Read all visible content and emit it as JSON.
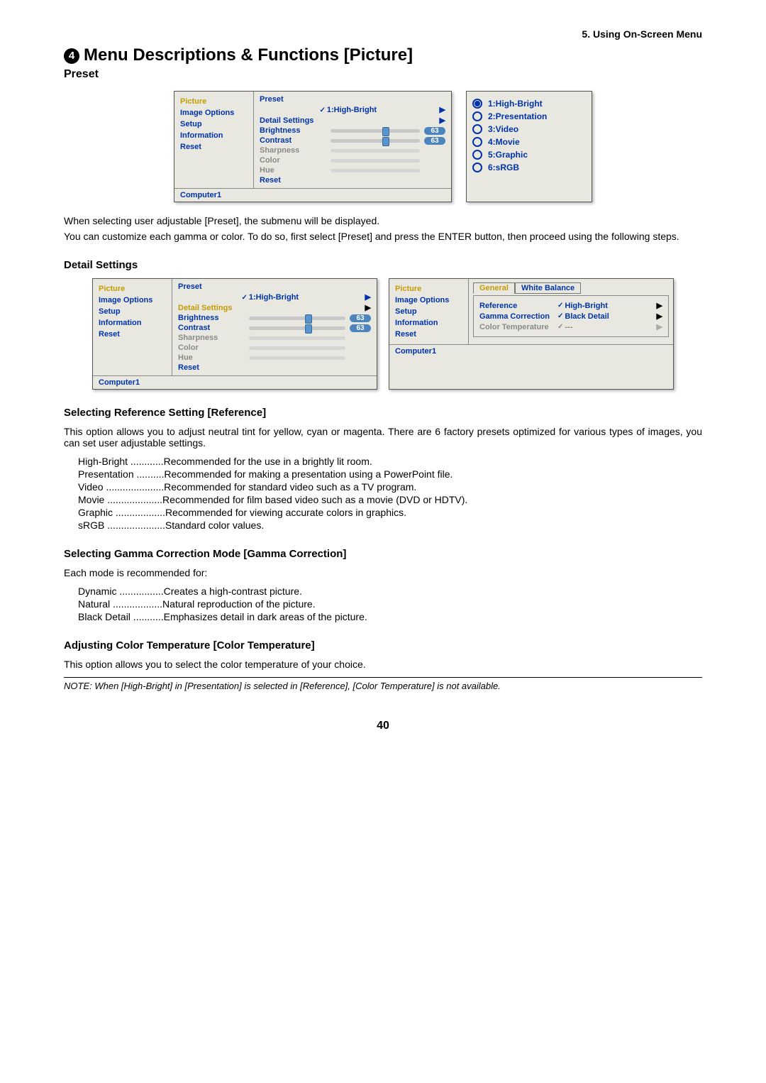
{
  "chapter": "5. Using On-Screen Menu",
  "title_number": "4",
  "title": "Menu Descriptions & Functions [Picture]",
  "preset_heading": "Preset",
  "osd1": {
    "side": [
      "Picture",
      "Image Options",
      "Setup",
      "Information",
      "Reset"
    ],
    "side_selected": 0,
    "preset_label": "Preset",
    "preset_value": "1:High-Bright",
    "detail": "Detail Settings",
    "brightness_label": "Brightness",
    "brightness_value": "63",
    "contrast_label": "Contrast",
    "contrast_value": "63",
    "sharpness_label": "Sharpness",
    "color_label": "Color",
    "hue_label": "Hue",
    "reset_label": "Reset",
    "status": "Computer1"
  },
  "popup": {
    "items": [
      "1:High-Bright",
      "2:Presentation",
      "3:Video",
      "4:Movie",
      "5:Graphic",
      "6:sRGB"
    ],
    "selected": 0
  },
  "para1": "When selecting user adjustable [Preset], the submenu will be displayed.",
  "para2": "You can customize each gamma or color. To do so, first select [Preset] and press the ENTER button, then proceed using the following steps.",
  "detail_heading": "Detail Settings",
  "osd2": {
    "side": [
      "Picture",
      "Image Options",
      "Setup",
      "Information",
      "Reset"
    ],
    "preset_label": "Preset",
    "preset_value": "1:High-Bright",
    "detail": "Detail Settings",
    "brightness_label": "Brightness",
    "brightness_value": "63",
    "contrast_label": "Contrast",
    "contrast_value": "63",
    "sharpness_label": "Sharpness",
    "color_label": "Color",
    "hue_label": "Hue",
    "reset_label": "Reset",
    "status": "Computer1"
  },
  "osd3": {
    "side": [
      "Picture",
      "Image Options",
      "Setup",
      "Information",
      "Reset"
    ],
    "tab_general": "General",
    "tab_wb": "White Balance",
    "reference_label": "Reference",
    "reference_value": "High-Bright",
    "gamma_label": "Gamma Correction",
    "gamma_value": "Black Detail",
    "colortemp_label": "Color Temperature",
    "colortemp_value": "---",
    "status": "Computer1"
  },
  "ref_heading": "Selecting Reference Setting [Reference]",
  "ref_para": "This option allows you to adjust neutral tint for yellow, cyan or magenta. There are 6 factory presets optimized for various types of images, you can set user adjustable settings.",
  "ref_defs": [
    {
      "term": "High-Bright",
      "desc": "Recommended for the use in a brightly lit room."
    },
    {
      "term": "Presentation",
      "desc": "Recommended for making a presentation using a PowerPoint file."
    },
    {
      "term": "Video",
      "desc": "Recommended for standard video such as a TV program."
    },
    {
      "term": "Movie",
      "desc": "Recommended for film based video such as a movie (DVD or HDTV)."
    },
    {
      "term": "Graphic",
      "desc": "Recommended for viewing accurate colors in graphics."
    },
    {
      "term": "sRGB",
      "desc": "Standard color values."
    }
  ],
  "gamma_heading": "Selecting Gamma Correction Mode [Gamma Correction]",
  "gamma_intro": "Each mode is recommended for:",
  "gamma_defs": [
    {
      "term": "Dynamic",
      "desc": "Creates a high-contrast picture."
    },
    {
      "term": "Natural",
      "desc": "Natural reproduction of the picture."
    },
    {
      "term": "Black Detail",
      "desc": "Emphasizes detail in dark areas of the picture."
    }
  ],
  "ct_heading": "Adjusting Color Temperature [Color Temperature]",
  "ct_para": "This option allows you to select the color temperature of your choice.",
  "note": "NOTE: When [High-Bright] in [Presentation] is selected in [Reference], [Color Temperature] is not available.",
  "page_number": "40"
}
